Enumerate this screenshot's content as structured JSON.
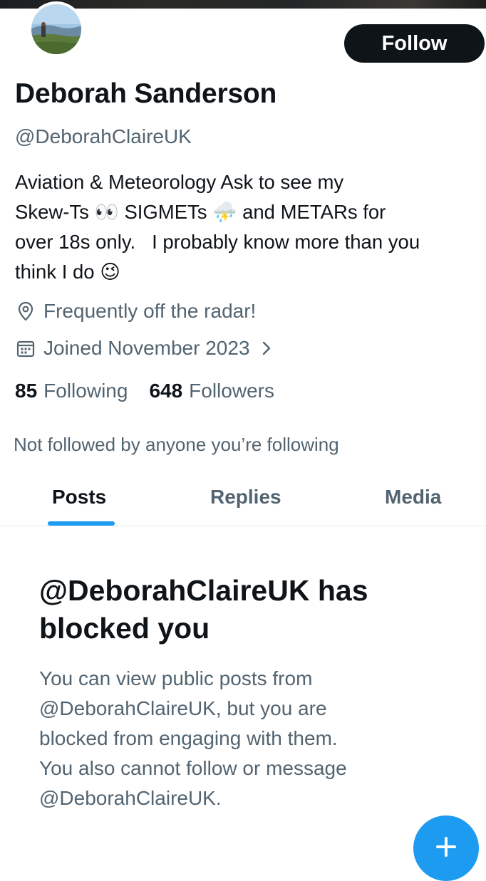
{
  "profile": {
    "display_name": "Deborah Sanderson",
    "handle": "@DeborahClaireUK",
    "follow_button_label": "Follow",
    "bio": {
      "line1": "Aviation & Meteorology Ask to see my",
      "line2_a": "Skew-Ts",
      "line2_emoji1": "👀",
      "line2_b": "SIGMETs",
      "line2_emoji2": "⛈️",
      "line2_c": "and METARs for",
      "line3": "over 18s only.   I probably know more than you",
      "line4_a": "think I do",
      "line4_emoji": "😉"
    },
    "location": "Frequently off the radar!",
    "joined": "Joined November 2023",
    "following_count": "85",
    "following_label": "Following",
    "followers_count": "648",
    "followers_label": "Followers",
    "not_followed_note": "Not followed by anyone you’re following"
  },
  "tabs": [
    {
      "label": "Posts",
      "active": true
    },
    {
      "label": "Replies",
      "active": false
    },
    {
      "label": "Media",
      "active": false
    }
  ],
  "blocked_notice": {
    "title_line1": "@DeborahClaireUK has",
    "title_line2": "blocked you",
    "body_line1": "You can view public posts from",
    "body_line2": "@DeborahClaireUK, but you are",
    "body_line3": "blocked from engaging with them.",
    "body_line4": "You also cannot follow or message",
    "body_line5": "@DeborahClaireUK."
  },
  "icons": {
    "location": "location-pin-icon",
    "calendar": "calendar-icon",
    "chevron": "chevron-right-icon",
    "compose": "plus-icon"
  },
  "colors": {
    "text_primary": "#0f1419",
    "text_secondary": "#536471",
    "accent": "#1d9bf0",
    "follow_button_bg": "#0f1419"
  }
}
